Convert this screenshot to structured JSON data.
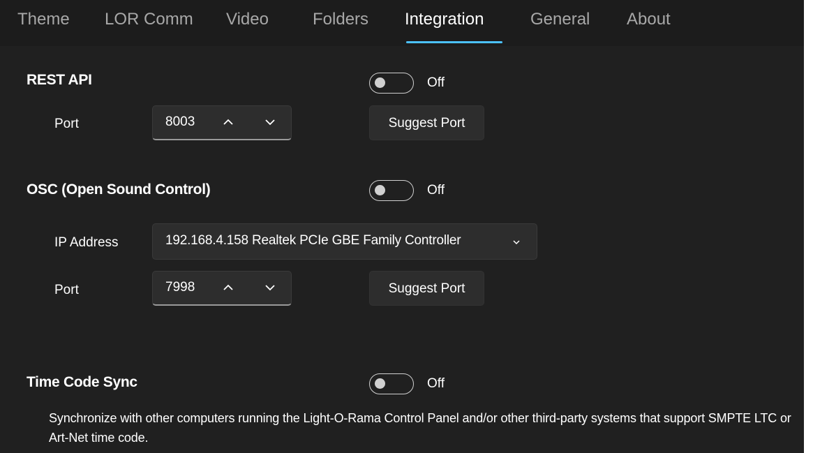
{
  "tabs": [
    {
      "label": "Theme",
      "active": false
    },
    {
      "label": "LOR Comm",
      "active": false
    },
    {
      "label": "Video",
      "active": false
    },
    {
      "label": "Folders",
      "active": false
    },
    {
      "label": "Integration",
      "active": true
    },
    {
      "label": "General",
      "active": false
    },
    {
      "label": "About",
      "active": false
    }
  ],
  "accent_color": "#4cc2ff",
  "rest_api": {
    "title": "REST API",
    "toggle_state": "Off",
    "port_label": "Port",
    "port_value": "8003",
    "suggest_button": "Suggest Port"
  },
  "osc": {
    "title": "OSC (Open Sound Control)",
    "toggle_state": "Off",
    "ip_label": "IP Address",
    "ip_value": "192.168.4.158  Realtek PCIe GBE Family Controller",
    "port_label": "Port",
    "port_value": "7998",
    "suggest_button": "Suggest Port"
  },
  "timecode": {
    "title": "Time Code Sync",
    "toggle_state": "Off",
    "description": "Synchronize with other computers running the Light-O-Rama Control Panel and/or other third-party systems that support SMPTE LTC or Art-Net time code."
  },
  "icons": {
    "spin_up": "chevron-up-icon",
    "spin_down": "chevron-down-icon",
    "dropdown": "chevron-down-icon"
  }
}
